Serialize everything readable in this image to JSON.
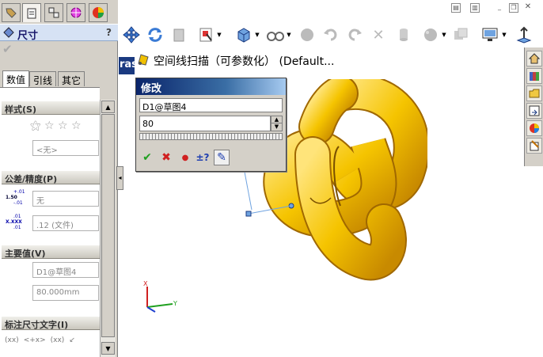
{
  "property_manager": {
    "title": "尺寸",
    "help": "?",
    "confirm": "✔",
    "tabs": [
      "数值",
      "引线",
      "其它"
    ],
    "groups": {
      "style": "样式(S)",
      "tolerance": "公差/精度(P)",
      "primary": "主要值(V)",
      "dim_text": "标注尺寸文字(I)"
    },
    "style_value": "<无>",
    "tolerance_type": "无",
    "tolerance_precision_label": "1.50",
    "tolerance_upper": "+.01",
    "tolerance_lower": "-.01",
    "precision_label": "X.XXX",
    "precision_upper": ".01",
    "precision_lower": ".01",
    "precision_value": ".12 (文件)",
    "primary_name": "D1@草图4",
    "primary_value": "80.000mm",
    "dim_text_buttons": [
      "(xx)",
      "<+x>",
      "(xx)",
      "↙"
    ]
  },
  "document": {
    "title": "空间线扫描（可参数化）  (Default...",
    "partial_label": "ras"
  },
  "modify_dialog": {
    "title": "修改",
    "name": "D1@草图4",
    "value": "80",
    "buttons": [
      "✔",
      "✖",
      "●",
      "±?",
      "✎"
    ]
  },
  "triad": {
    "x": "X",
    "y": "Y"
  },
  "colors": {
    "accent": "#0a246a",
    "part": "#f5c400",
    "part_shadow": "#c88a00"
  }
}
